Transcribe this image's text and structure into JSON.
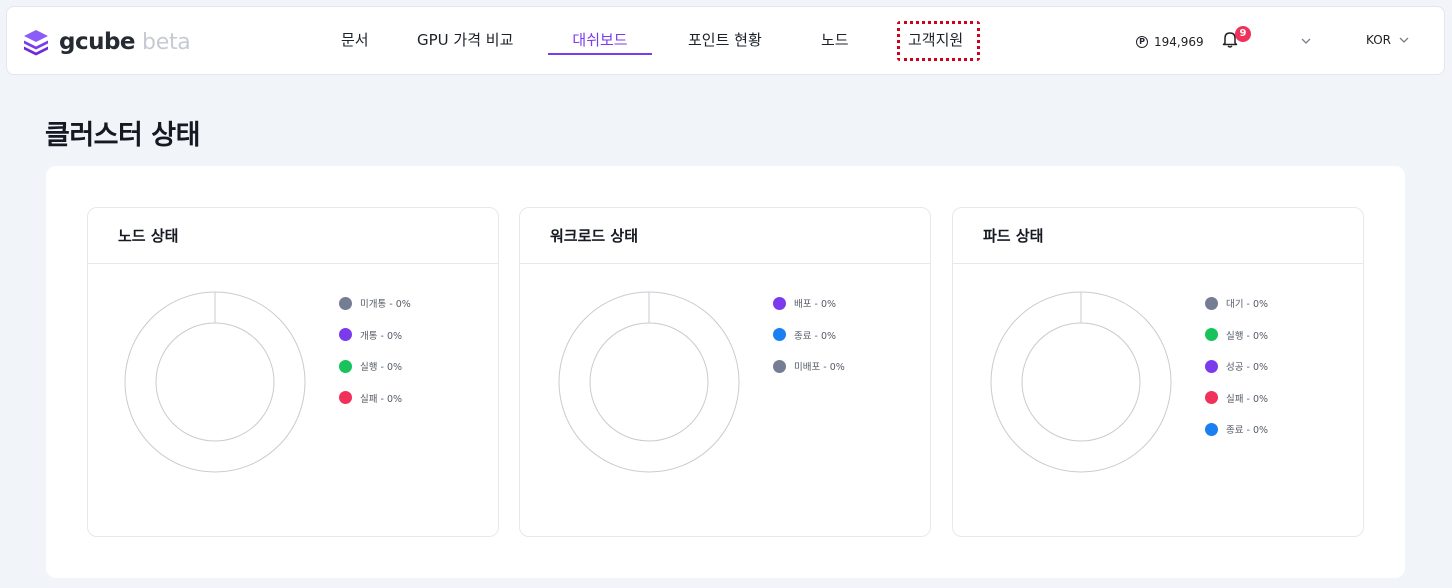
{
  "colors": {
    "accent": "#7c3aed",
    "highlight": "#d0021b",
    "gray": "#757d94",
    "purple": "#7c3aed",
    "green": "#17c35a",
    "red": "#f0325a",
    "blue": "#1a7ff0"
  },
  "logo": {
    "name": "gcube",
    "suffix": "beta",
    "icon": "stacked-cube-icon"
  },
  "nav": {
    "items": [
      "문서",
      "GPU 가격 비교",
      "대쉬보드",
      "포인트 현황",
      "노드",
      "고객지원"
    ],
    "active_index": 2,
    "highlighted_index": 5
  },
  "header_right": {
    "points_icon": "P",
    "points": "194,969",
    "notifications_count": "9",
    "language": "KOR"
  },
  "page": {
    "title": "클러스터 상태"
  },
  "cards": [
    {
      "title": "노드 상태",
      "legend": [
        {
          "label": "미개통 - 0%",
          "color": "gray"
        },
        {
          "label": "개통 - 0%",
          "color": "purple"
        },
        {
          "label": "실행 - 0%",
          "color": "green"
        },
        {
          "label": "실패 - 0%",
          "color": "red"
        }
      ]
    },
    {
      "title": "워크로드 상태",
      "legend": [
        {
          "label": "배포 - 0%",
          "color": "purple"
        },
        {
          "label": "종료 - 0%",
          "color": "blue"
        },
        {
          "label": "미배포 - 0%",
          "color": "gray"
        }
      ]
    },
    {
      "title": "파드 상태",
      "legend": [
        {
          "label": "대기 - 0%",
          "color": "gray"
        },
        {
          "label": "실행 - 0%",
          "color": "green"
        },
        {
          "label": "성공 - 0%",
          "color": "purple"
        },
        {
          "label": "실패 - 0%",
          "color": "red"
        },
        {
          "label": "종료 - 0%",
          "color": "blue"
        }
      ]
    }
  ]
}
